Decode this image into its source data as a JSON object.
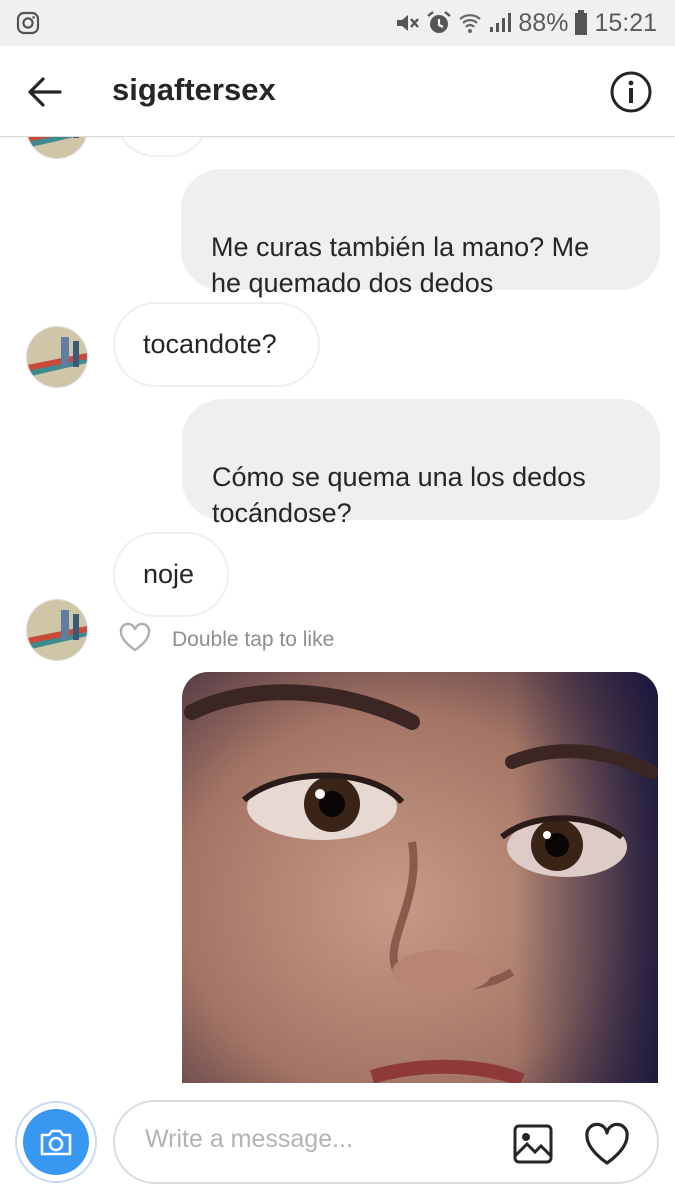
{
  "status_bar": {
    "battery": "88%",
    "time": "15:21"
  },
  "header": {
    "username": "sigaftersex"
  },
  "messages": [
    {
      "text": "Me curas también la mano? Me\nhe quemado dos dedos"
    },
    {
      "text": "tocandote?"
    },
    {
      "text": "Cómo se quema una los dedos\ntocándose?"
    },
    {
      "text": "noje"
    }
  ],
  "like_hint": "Double tap to like",
  "composer": {
    "placeholder": "Write a message..."
  },
  "colors": {
    "accent": "#3897f0",
    "outgoing_bubble": "#efefef"
  }
}
